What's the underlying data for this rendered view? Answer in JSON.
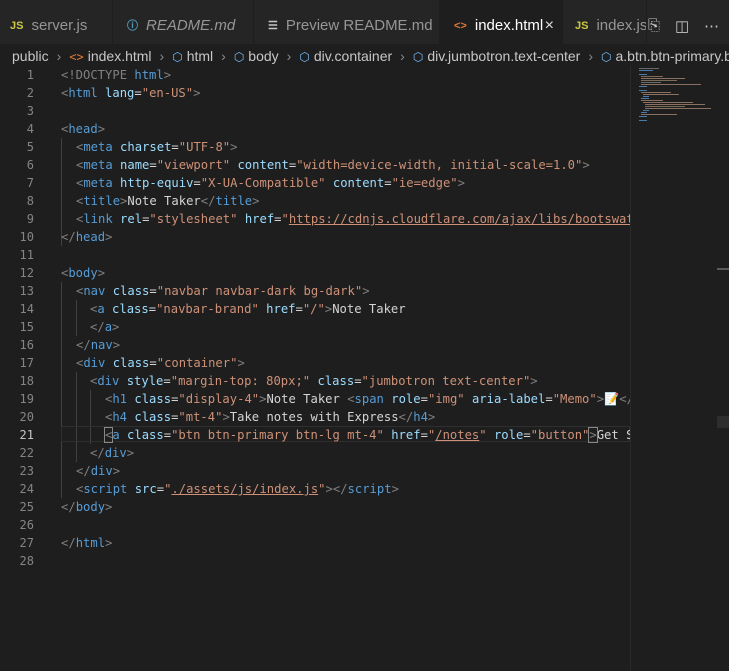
{
  "tabs": [
    {
      "icon": "JS",
      "label": "server.js",
      "italic": false,
      "active": false
    },
    {
      "icon": "md-info",
      "label": "README.md",
      "italic": true,
      "active": false
    },
    {
      "icon": "preview",
      "label": "Preview README.md",
      "italic": false,
      "active": false
    },
    {
      "icon": "<>",
      "label": "index.html",
      "italic": false,
      "active": true,
      "close": "×"
    },
    {
      "icon": "JS",
      "label": "index.js",
      "italic": false,
      "active": false
    }
  ],
  "breadcrumb": [
    "public",
    "index.html",
    "html",
    "body",
    "div.container",
    "div.jumbotron.text-center",
    "a.btn.btn-primary.b"
  ],
  "line_numbers": [
    "1",
    "2",
    "3",
    "4",
    "5",
    "6",
    "7",
    "8",
    "9",
    "10",
    "11",
    "12",
    "13",
    "14",
    "15",
    "16",
    "17",
    "18",
    "19",
    "20",
    "21",
    "22",
    "23",
    "24",
    "25",
    "26",
    "27",
    "28"
  ],
  "current_line": "21",
  "code": {
    "l1_doctype": "<!DOCTYPE",
    "l1_html": " html",
    "l1_close": ">",
    "l2_open": "<",
    "l2_tag": "html",
    "l2_attr": " lang",
    "l2_eq": "=",
    "l2_val": "\"en-US\"",
    "l2_close": ">",
    "l4_text": "<head>",
    "l5_tag": "meta",
    "l5_attr": "charset",
    "l5_val": "\"UTF-8\"",
    "l6_tag": "meta",
    "l6_a1": "name",
    "l6_v1": "\"viewport\"",
    "l6_a2": "content",
    "l6_v2": "\"width=device-width, initial-scale=1.0\"",
    "l7_tag": "meta",
    "l7_a1": "http-equiv",
    "l7_v1": "\"X-UA-Compatible\"",
    "l7_a2": "content",
    "l7_v2": "\"ie=edge\"",
    "l8_tag": "title",
    "l8_text": "Note Taker",
    "l9_tag": "link",
    "l9_a1": "rel",
    "l9_v1": "\"stylesheet\"",
    "l9_a2": "href",
    "l9_v2q": "\"",
    "l9_v2": "https://cdnjs.cloudflare.com/ajax/libs/bootswatc",
    "l10_tag": "head",
    "l12_tag": "body",
    "l13_tag": "nav",
    "l13_a1": "class",
    "l13_v1": "\"navbar navbar-dark bg-dark\"",
    "l14_tag": "a",
    "l14_a1": "class",
    "l14_v1": "\"navbar-brand\"",
    "l14_a2": "href",
    "l14_v2": "\"/\"",
    "l14_text": "Note Taker",
    "l15_tag": "a",
    "l16_tag": "nav",
    "l17_tag": "div",
    "l17_a1": "class",
    "l17_v1": "\"container\"",
    "l18_tag": "div",
    "l18_a1": "style",
    "l18_v1": "\"margin-top: 80px;\"",
    "l18_a2": "class",
    "l18_v2": "\"jumbotron text-center\"",
    "l19_tag": "h1",
    "l19_a1": "class",
    "l19_v1": "\"display-4\"",
    "l19_text": "Note Taker ",
    "l19_tag2": "span",
    "l19_a2": "role",
    "l19_v2": "\"img\"",
    "l19_a3": "aria-label",
    "l19_v3": "\"Memo\"",
    "l19_emoji": "📝",
    "l19_end": "</s",
    "l20_tag": "h4",
    "l20_a1": "class",
    "l20_v1": "\"mt-4\"",
    "l20_text": "Take notes with Express",
    "l21_tag": "a",
    "l21_a1": "class",
    "l21_v1": "\"btn btn-primary btn-lg mt-4\"",
    "l21_a2": "href",
    "l21_v2": "/notes",
    "l21_a3": "role",
    "l21_v3": "\"button\"",
    "l21_text": "Get St",
    "l22_tag": "div",
    "l23_tag": "div",
    "l24_tag": "script",
    "l24_a1": "src",
    "l24_v1": "./assets/js/index.js",
    "l25_tag": "body",
    "l27_tag": "html"
  }
}
